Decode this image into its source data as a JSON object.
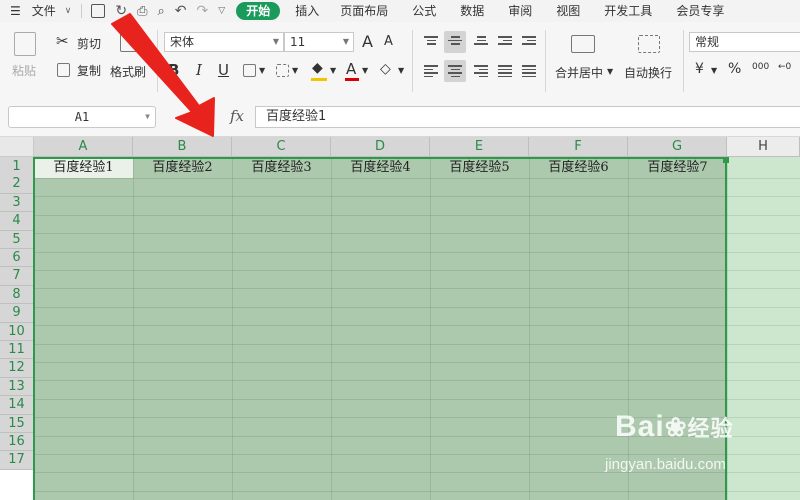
{
  "menu": {
    "file": "文件",
    "tabs": [
      "开始",
      "插入",
      "页面布局",
      "公式",
      "数据",
      "审阅",
      "视图",
      "开发工具",
      "会员专享"
    ]
  },
  "ribbon": {
    "paste": "粘贴",
    "cut": "剪切",
    "copy": "复制",
    "format_painter": "格式刷",
    "font_name": "宋体",
    "font_size": "11",
    "merge_center": "合并居中",
    "wrap_text": "自动换行",
    "number_format": "常规",
    "currency_symbol": "¥",
    "percent_symbol": "%",
    "increase_decimal": "000",
    "decrease_decimal": "←0",
    "grow_font": "A",
    "shrink_font": "A",
    "bold": "B",
    "italic": "I",
    "underline": "U"
  },
  "formula_bar": {
    "name_box": "A1",
    "fx": "fx",
    "content": "百度经验1"
  },
  "grid": {
    "columns": [
      "A",
      "B",
      "C",
      "D",
      "E",
      "F",
      "G",
      "H"
    ],
    "rows": [
      "1",
      "2",
      "3",
      "4",
      "5",
      "6",
      "7",
      "8",
      "9",
      "10",
      "11",
      "12",
      "13",
      "14",
      "15",
      "16",
      "17"
    ],
    "row1_values": [
      "百度经验1",
      "百度经验2",
      "百度经验3",
      "百度经验4",
      "百度经验5",
      "百度经验6",
      "百度经验7"
    ]
  },
  "watermark": {
    "logo_left": "Bai",
    "logo_right": "经验",
    "url": "jingyan.baidu.com"
  },
  "colors": {
    "accent": "#1a9b5c",
    "selection_fill": "#acc8ad",
    "selection_border": "#2d9a4a",
    "arrow": "#e8231d"
  }
}
